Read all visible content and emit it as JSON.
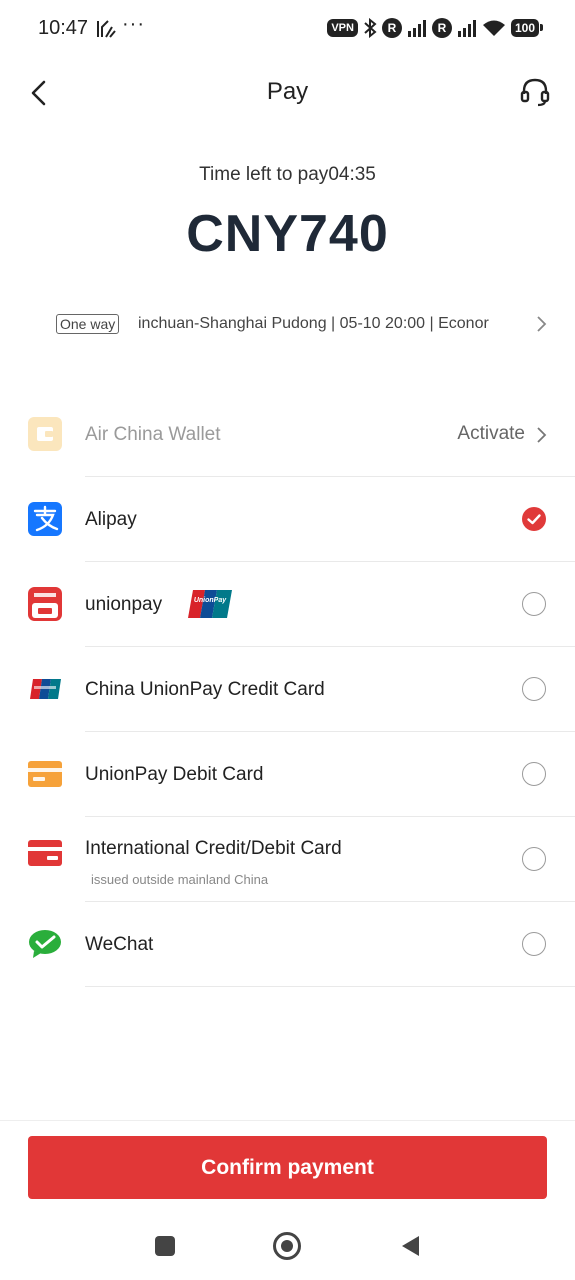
{
  "status_bar": {
    "time": "10:47",
    "dots": "···",
    "vpn": "VPN",
    "roaming_1": "R",
    "roaming_2": "R",
    "battery": "100"
  },
  "header": {
    "title": "Pay",
    "back_icon": "chevron-left-icon",
    "support_icon": "headset-icon"
  },
  "payment": {
    "time_left_label": "Time left to pay",
    "time_left_value": "04:35",
    "amount": "CNY740"
  },
  "trip": {
    "badge": "One way",
    "summary": "inchuan-Shanghai Pudong | 05-10 20:00 | Econor"
  },
  "methods": [
    {
      "name": "Air China Wallet",
      "icon": "wallet-icon",
      "action": "Activate",
      "state": "disabled"
    },
    {
      "name": "Alipay",
      "icon": "alipay-icon",
      "state": "selected"
    },
    {
      "name": "unionpay",
      "icon": "cloud-quickpass-icon",
      "logo": "UnionPay",
      "state": "unselected"
    },
    {
      "name": "China UnionPay Credit Card",
      "icon": "unionpay-card-icon",
      "state": "unselected"
    },
    {
      "name": "UnionPay Debit Card",
      "icon": "debit-card-icon",
      "state": "unselected"
    },
    {
      "name": "International Credit/Debit Card",
      "subtitle": "issued outside mainland China",
      "icon": "credit-card-icon",
      "state": "unselected"
    },
    {
      "name": "WeChat",
      "icon": "wechat-pay-icon",
      "state": "unselected"
    }
  ],
  "confirm_label": "Confirm payment",
  "colors": {
    "accent_red": "#e13737",
    "amount_text": "#1f2937",
    "alipay_blue": "#1677ff",
    "wechat_green": "#2aae3b",
    "wallet_tan": "#f7dca6",
    "debit_orange": "#f6a23a"
  }
}
